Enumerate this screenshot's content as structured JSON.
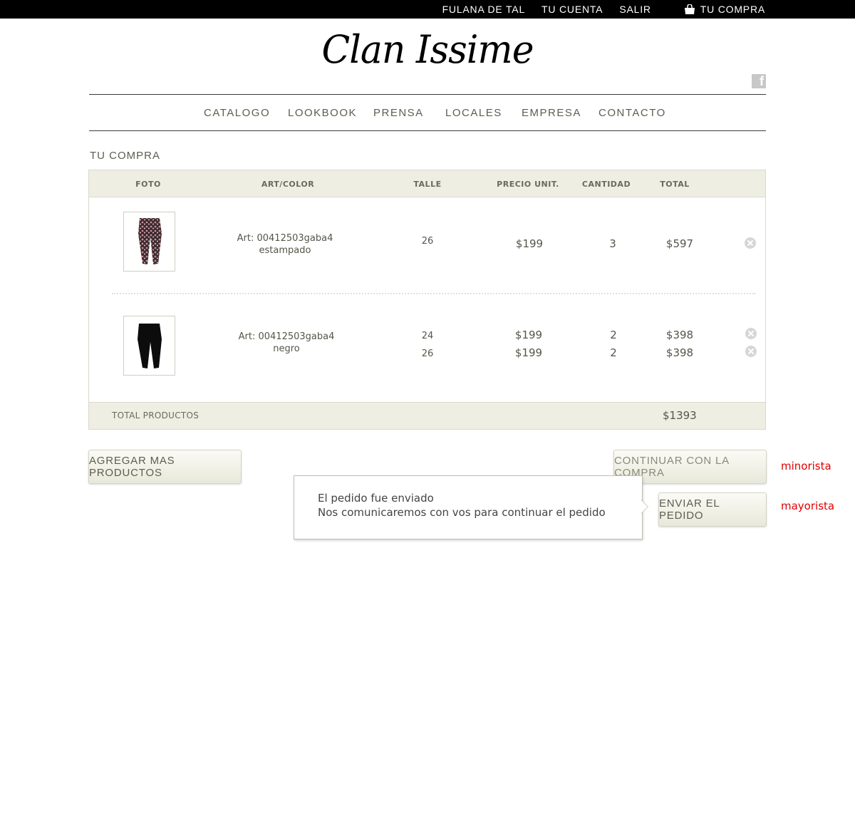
{
  "topbar": {
    "user": "FULANA DE TAL",
    "account": "TU CUENTA",
    "logout": "SALIR",
    "cart": "TU COMPRA"
  },
  "logo": "Clan Issime",
  "icons": {
    "social": "facebook-icon",
    "cart": "shopping-bag-icon",
    "remove": "remove-circle-icon"
  },
  "nav": [
    "CATALOGO",
    "LOOKBOOK",
    "PRENSA",
    "LOCALES",
    "EMPRESA",
    "CONTACTO"
  ],
  "page_title": "TU COMPRA",
  "cart": {
    "headers": {
      "foto": "FOTO",
      "art": "ART/COLOR",
      "talle": "TALLE",
      "precio": "PRECIO UNIT.",
      "cantidad": "CANTIDAD",
      "total": "TOTAL"
    },
    "items": [
      {
        "art": "Art: 00412503gaba4",
        "color": "estampado",
        "lines": [
          {
            "talle": "26",
            "precio": "$199",
            "cantidad": "3",
            "total": "$597"
          }
        ]
      },
      {
        "art": "Art: 00412503gaba4",
        "color": "negro",
        "lines": [
          {
            "talle": "24",
            "precio": "$199",
            "cantidad": "2",
            "total": "$398"
          },
          {
            "talle": "26",
            "precio": "$199",
            "cantidad": "2",
            "total": "$398"
          }
        ]
      }
    ],
    "total_label": "TOTAL PRODUCTOS",
    "total_value": "$1393"
  },
  "buttons": {
    "add_more": "AGREGAR MAS PRODUCTOS",
    "continue": "CONTINUAR CON LA COMPRA",
    "send": "ENVIAR EL PEDIDO"
  },
  "annotations": {
    "retail": "minorista",
    "wholesale": "mayorista"
  },
  "tooltip": {
    "line1": "El pedido fue enviado",
    "line2": "Nos comunicaremos con vos para continuar el pedido"
  },
  "colors": {
    "topbar": "#000000",
    "header_bg": "#eeeee2",
    "annotation": "#e00000"
  }
}
